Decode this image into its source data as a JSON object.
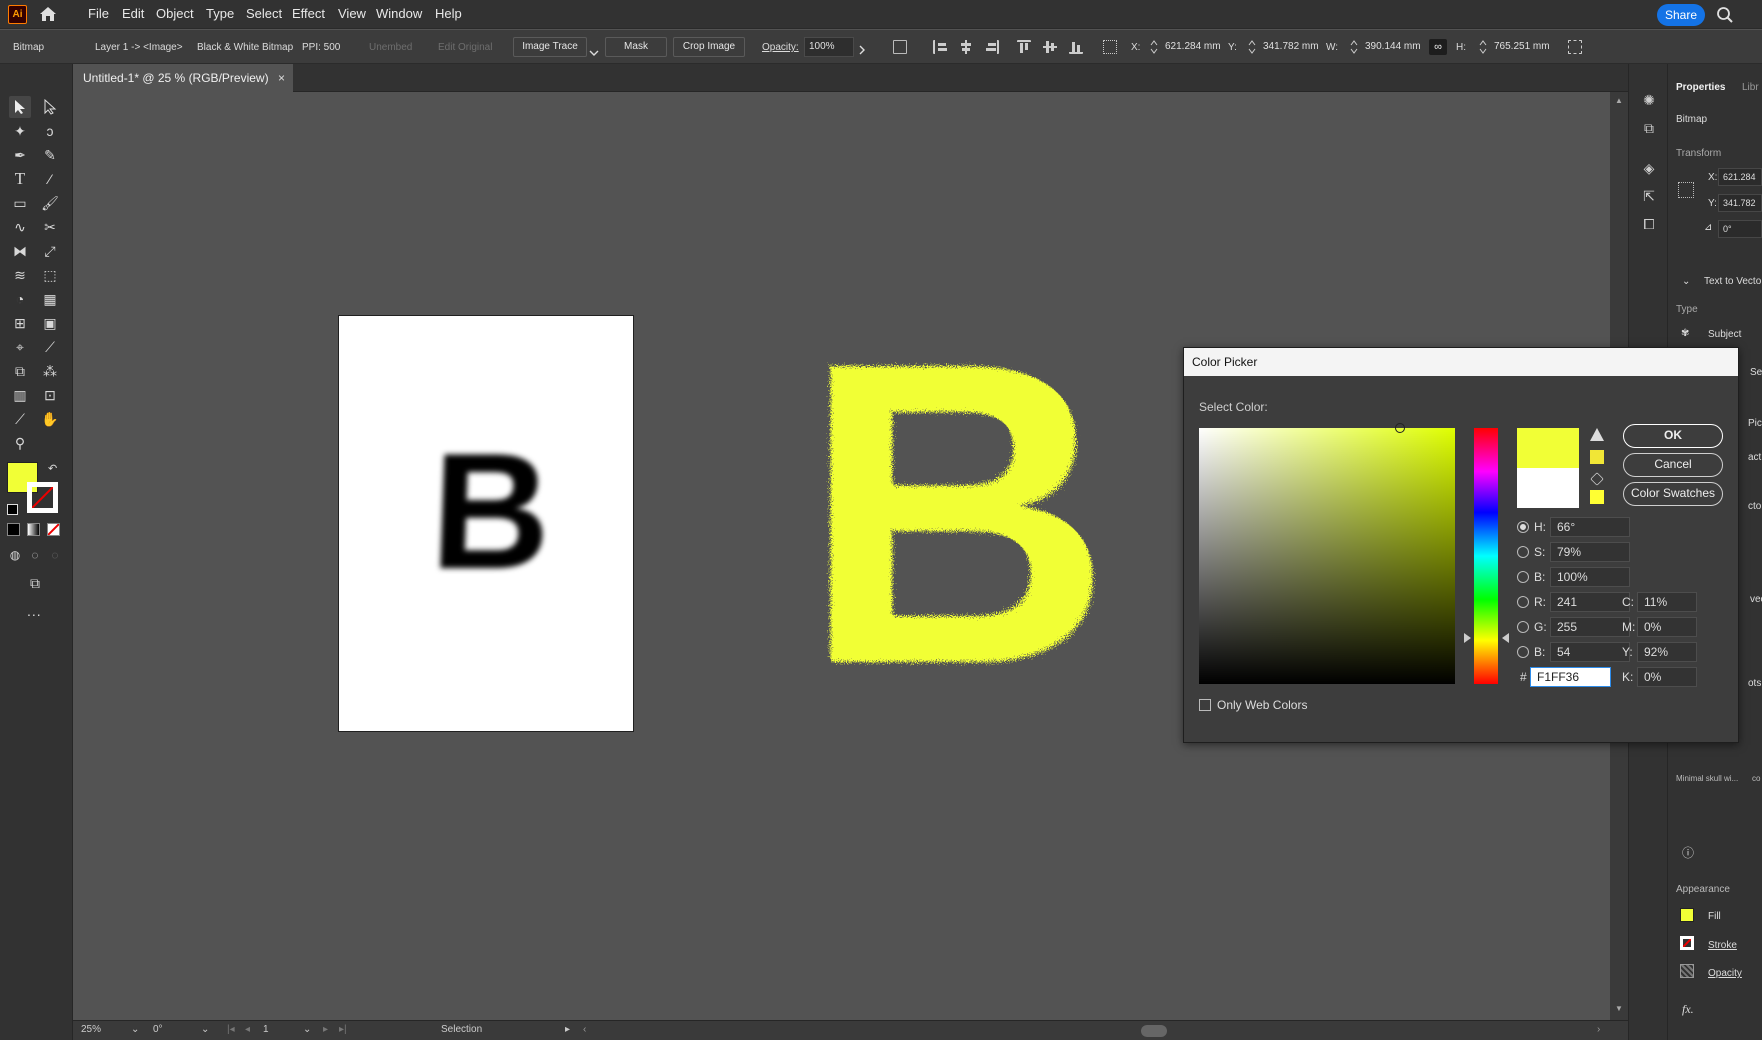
{
  "app": {
    "logo": "Ai"
  },
  "menu": {
    "items": [
      "File",
      "Edit",
      "Object",
      "Type",
      "Select",
      "Effect",
      "View",
      "Window",
      "Help"
    ],
    "share_label": "Share"
  },
  "control_bar": {
    "object_type": "Bitmap",
    "layer_path": "Layer 1 -> <Image>",
    "color_mode": "Black & White Bitmap",
    "ppi": "PPI: 500",
    "unembed": "Unembed",
    "edit_original": "Edit Original",
    "image_trace": "Image Trace",
    "mask": "Mask",
    "crop_image": "Crop Image",
    "opacity_label": "Opacity:",
    "opacity_value": "100%",
    "x_label": "X:",
    "x_value": "621.284 mm",
    "y_label": "Y:",
    "y_value": "341.782 mm",
    "w_label": "W:",
    "w_value": "390.144 mm",
    "h_label": "H:",
    "h_value": "765.251 mm"
  },
  "document": {
    "tab_title": "Untitled-1* @ 25 % (RGB/Preview)",
    "close": "×"
  },
  "canvas": {
    "artboard_letter": "B",
    "traced_letter": "B",
    "traced_color": "#F1FF36"
  },
  "status": {
    "zoom": "25%",
    "rotation": "0°",
    "artboard_num": "1",
    "tool": "Selection"
  },
  "tools": {
    "fill_color": "#F1FF36",
    "more": "..."
  },
  "properties": {
    "tab_properties": "Properties",
    "tab_libraries": "Libr",
    "object_type": "Bitmap",
    "transform": "Transform",
    "x_label": "X:",
    "x_value": "621.284",
    "y_label": "Y:",
    "y_value": "341.782",
    "angle": "0°",
    "text_to_vector": "Text to Vecto",
    "type_label": "Type",
    "subject": "Subject",
    "frag_se": "Se",
    "frag_pick": "Pick s",
    "frag_active": "active",
    "frag_ctor": "ctor g",
    "frag_vect": "vect",
    "frag_ots": "ots",
    "thumb_caption": "Minimal skull wi...",
    "frag_col": "co",
    "appearance": "Appearance",
    "fill": "Fill",
    "stroke": "Stroke",
    "opacity": "Opacity",
    "fx": "fx."
  },
  "color_picker": {
    "title": "Color Picker",
    "select_color": "Select Color:",
    "ok": "OK",
    "cancel": "Cancel",
    "swatches": "Color Swatches",
    "h_label": "H:",
    "h": "66°",
    "s_label": "S:",
    "s": "79%",
    "b_label": "B:",
    "b": "100%",
    "r_label": "R:",
    "r": "241",
    "g_label": "G:",
    "g": "255",
    "b2_label": "B:",
    "b2": "54",
    "c_label": "C:",
    "c": "11%",
    "m_label": "M:",
    "m": "0%",
    "y_label": "Y:",
    "y": "92%",
    "k_label": "K:",
    "k": "0%",
    "hash": "#",
    "hex": "F1FF36",
    "only_web": "Only Web Colors",
    "new_color": "#F1FF36",
    "old_color": "#FFFFFF"
  }
}
